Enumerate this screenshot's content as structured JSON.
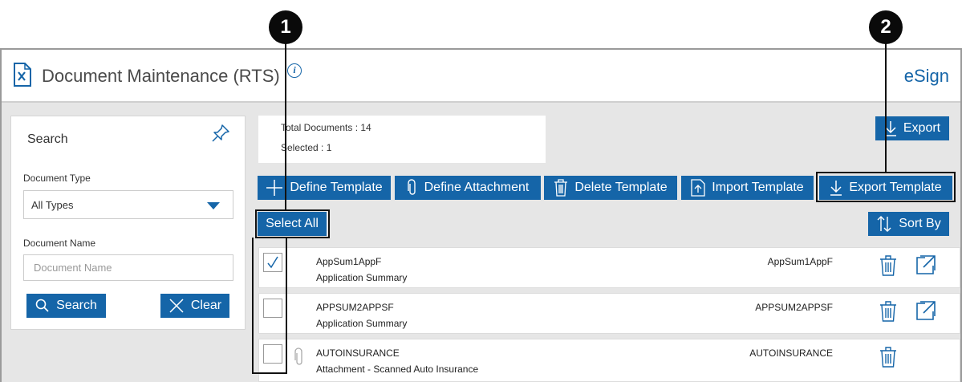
{
  "header": {
    "title": "Document Maintenance (RTS)",
    "brand": "eSign"
  },
  "search": {
    "title": "Search",
    "document_type_label": "Document Type",
    "document_type_value": "All Types",
    "document_name_label": "Document Name",
    "document_name_placeholder": "Document Name",
    "search_button": "Search",
    "clear_button": "Clear"
  },
  "summary": {
    "total": "Total Documents : 14",
    "selected": "Selected : 1"
  },
  "toolbar": {
    "export": "Export",
    "define_template": "Define Template",
    "define_attachment": "Define Attachment",
    "delete_template": "Delete Template",
    "import_template": "Import Template",
    "export_template": "Export Template",
    "select_all": "Select All",
    "sort_by": "Sort By"
  },
  "documents": [
    {
      "name": "AppSum1AppF",
      "description": "Application Summary",
      "code": "AppSum1AppF",
      "checked": true,
      "attachment": false
    },
    {
      "name": "APPSUM2APPSF",
      "description": "Application Summary",
      "code": "APPSUM2APPSF",
      "checked": false,
      "attachment": false
    },
    {
      "name": "AUTOINSURANCE",
      "description": "Attachment - Scanned Auto Insurance",
      "code": "AUTOINSURANCE",
      "checked": false,
      "attachment": true
    }
  ],
  "callouts": [
    "1",
    "2"
  ],
  "colors": {
    "accent": "#1565a8",
    "background": "#e6e6e6",
    "callout": "#0a0a0a"
  },
  "icons": [
    "document-icon",
    "info-icon",
    "pin-icon",
    "search-icon",
    "clear-icon",
    "download-icon",
    "plus-icon",
    "paperclip-icon",
    "trash-icon",
    "import-icon",
    "sort-icon",
    "open-window-icon",
    "checkmark-icon"
  ]
}
